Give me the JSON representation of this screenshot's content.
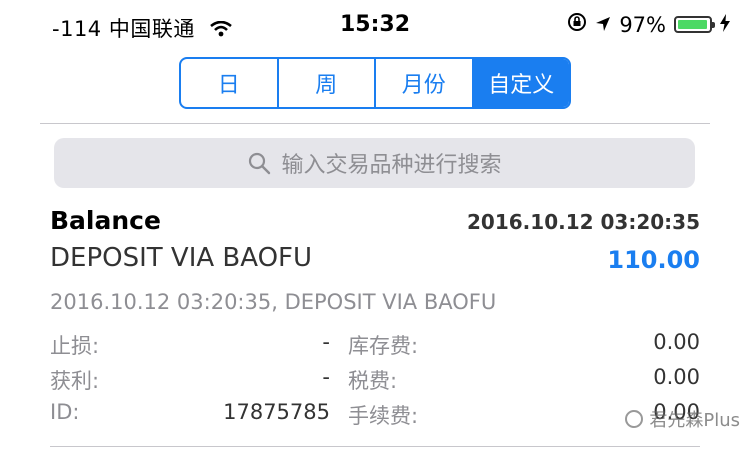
{
  "status_bar": {
    "signal": "-114",
    "carrier": "中国联通",
    "time": "15:32",
    "battery_percent": "97%",
    "battery_level": 0.97
  },
  "segments": {
    "items": [
      "日",
      "周",
      "月份",
      "自定义"
    ],
    "selected": "自定义"
  },
  "search": {
    "placeholder": "输入交易品种进行搜索"
  },
  "record": {
    "title": "Balance",
    "datetime": "2016.10.12 03:20:35",
    "description": "DEPOSIT VIA BAOFU",
    "amount": "110.00",
    "meta": "2016.10.12 03:20:35, DEPOSIT VIA BAOFU",
    "fields": [
      {
        "label": "止损:",
        "value": "-",
        "label2": "库存费:",
        "value2": "0.00"
      },
      {
        "label": "获利:",
        "value": "-",
        "label2": "税费:",
        "value2": "0.00"
      },
      {
        "label": "ID:",
        "value": "17875785",
        "label2": "手续费:",
        "value2": "0.00"
      }
    ]
  },
  "watermark": "君先森Plus",
  "colors": {
    "accent": "#1a7ef0",
    "battery": "#4cd964"
  }
}
